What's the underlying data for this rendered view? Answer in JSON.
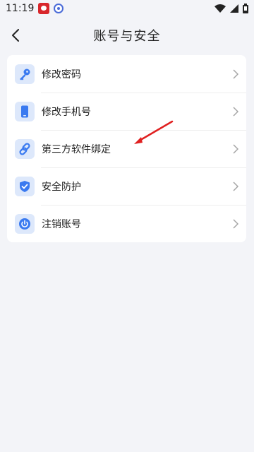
{
  "status_bar": {
    "time": "11:19",
    "icons": [
      "panda-app-icon",
      "blue-app-icon",
      "wifi-icon",
      "signal-icon",
      "battery-icon"
    ]
  },
  "header": {
    "title": "账号与安全",
    "back_icon": "chevron-left-icon"
  },
  "menu": {
    "items": [
      {
        "label": "修改密码",
        "icon": "key-icon"
      },
      {
        "label": "修改手机号",
        "icon": "phone-icon"
      },
      {
        "label": "第三方软件绑定",
        "icon": "link-icon"
      },
      {
        "label": "安全防护",
        "icon": "shield-check-icon"
      },
      {
        "label": "注销账号",
        "icon": "power-icon"
      }
    ]
  },
  "colors": {
    "accent": "#3a7af0",
    "icon_bg": "#dde8fb",
    "background": "#f3f4f8",
    "annotation_arrow": "#e02020"
  }
}
